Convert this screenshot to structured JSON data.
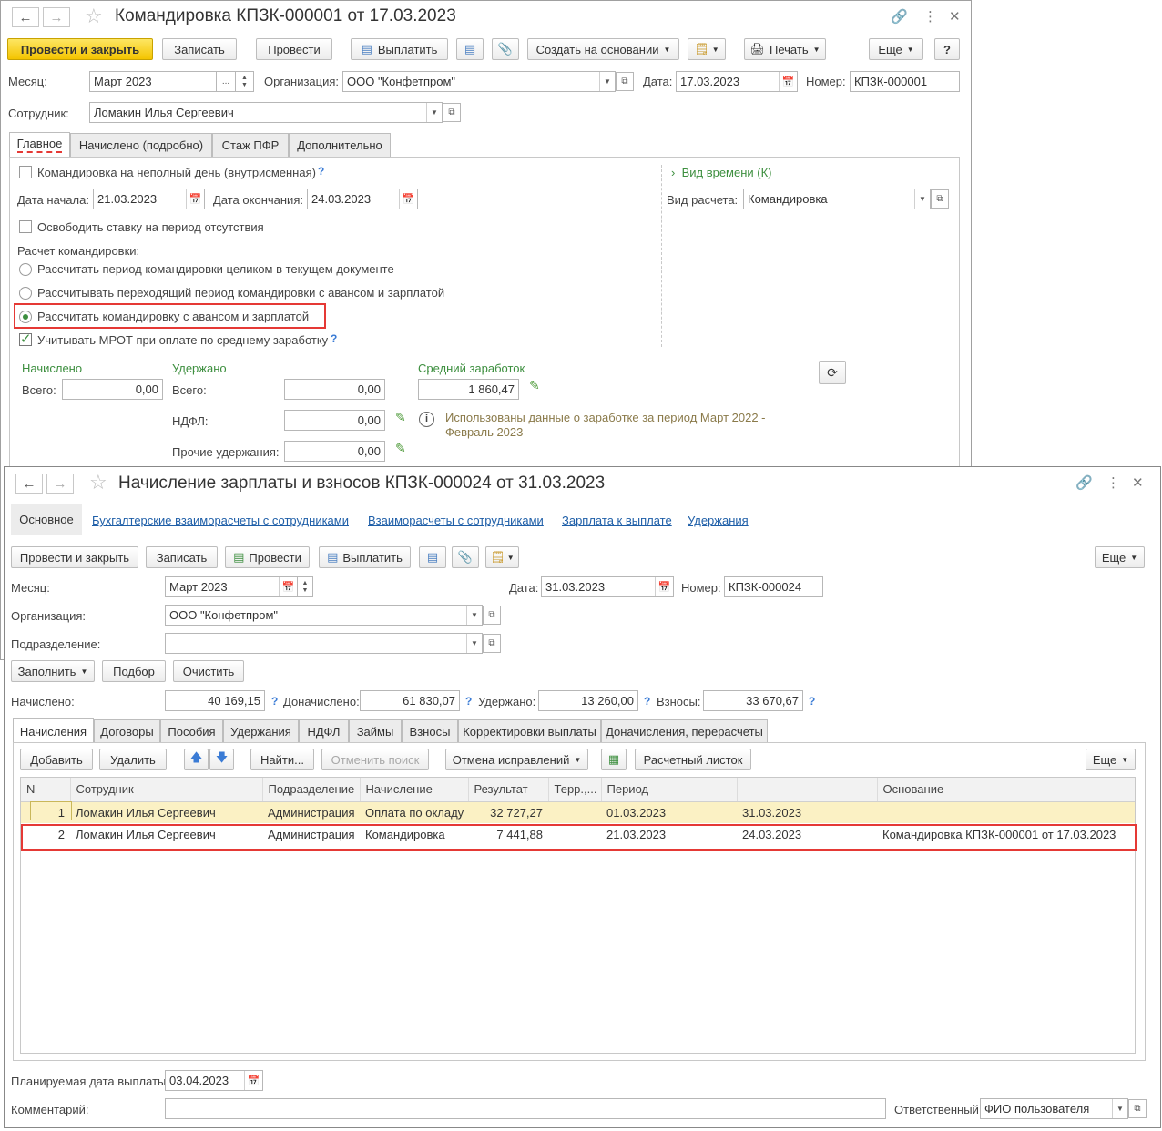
{
  "w1": {
    "title": "Командировка КПЗК-000001 от 17.03.2023",
    "toolbar": {
      "post_close": "Провести и закрыть",
      "save": "Записать",
      "post": "Провести",
      "pay": "Выплатить",
      "create_based": "Создать на основании",
      "print": "Печать",
      "more": "Еще",
      "help": "?"
    },
    "month_label": "Месяц:",
    "month_value": "Март 2023",
    "org_label": "Организация:",
    "org_value": "ООО \"Конфетпром\"",
    "date_label": "Дата:",
    "date_value": "17.03.2023",
    "number_label": "Номер:",
    "number_value": "КПЗК-000001",
    "employee_label": "Сотрудник:",
    "employee_value": "Ломакин Илья Сергеевич",
    "tabs": [
      "Главное",
      "Начислено (подробно)",
      "Стаж ПФР",
      "Дополнительно"
    ],
    "partial_day": "Командировка на неполный день (внутрисменная)",
    "start_label": "Дата начала:",
    "start_value": "21.03.2023",
    "end_label": "Дата окончания:",
    "end_value": "24.03.2023",
    "free_rate": "Освободить ставку на период отсутствия",
    "calc_header": "Расчет командировки:",
    "calc_options": [
      "Рассчитать период командировки целиком в текущем документе",
      "Рассчитывать переходящий период командировки с авансом и зарплатой",
      "Рассчитать командировку с авансом и зарплатой"
    ],
    "mrot": "Учитывать МРОТ при оплате по среднему заработку",
    "time_type": "Вид времени (К)",
    "calc_type_label": "Вид расчета:",
    "calc_type_value": "Командировка",
    "accrued_header": "Начислено",
    "accrued_total_label": "Всего:",
    "accrued_total": "0,00",
    "withheld_header": "Удержано",
    "withheld_total_label": "Всего:",
    "withheld_total": "0,00",
    "ndfl_label": "НДФЛ:",
    "ndfl_value": "0,00",
    "other_label": "Прочие удержания:",
    "other_value": "0,00",
    "avg_header": "Средний заработок",
    "avg_value": "1 860,47",
    "info_text_1": "Использованы данные о заработке за период Март 2022 -",
    "info_text_2": "Февраль 2023"
  },
  "w2": {
    "title": "Начисление зарплаты и взносов КПЗК-000024 от 31.03.2023",
    "sections": [
      "Основное",
      "Бухгалтерские взаиморасчеты с сотрудниками",
      "Взаиморасчеты с сотрудниками",
      "Зарплата к выплате",
      "Удержания"
    ],
    "toolbar": {
      "post_close": "Провести и закрыть",
      "save": "Записать",
      "post": "Провести",
      "pay": "Выплатить",
      "more": "Еще"
    },
    "month_label": "Месяц:",
    "month_value": "Март 2023",
    "date_label": "Дата:",
    "date_value": "31.03.2023",
    "number_label": "Номер:",
    "number_value": "КПЗК-000024",
    "org_label": "Организация:",
    "org_value": "ООО \"Конфетпром\"",
    "dept_label": "Подразделение:",
    "dept_value": "",
    "fill": "Заполнить",
    "select": "Подбор",
    "clear": "Очистить",
    "accrued_label": "Начислено:",
    "accrued_value": "40 169,15",
    "add_accrued_label": "Доначислено:",
    "add_accrued_value": "61 830,07",
    "withheld_label": "Удержано:",
    "withheld_value": "13 260,00",
    "contrib_label": "Взносы:",
    "contrib_value": "33 670,67",
    "tabs": [
      "Начисления",
      "Договоры",
      "Пособия",
      "Удержания",
      "НДФЛ",
      "Займы",
      "Взносы",
      "Корректировки выплаты",
      "Доначисления, перерасчеты"
    ],
    "tbl_toolbar": {
      "add": "Добавить",
      "delete": "Удалить",
      "find": "Найти...",
      "cancel_search": "Отменить поиск",
      "cancel_fix": "Отмена исправлений",
      "payslip": "Расчетный листок",
      "more": "Еще"
    },
    "columns": [
      "N",
      "Сотрудник",
      "Подразделение",
      "Начисление",
      "Результат",
      "Терр.,...",
      "Период",
      "",
      "Основание"
    ],
    "rows": [
      [
        "1",
        "Ломакин Илья Сергеевич",
        "Администрация",
        "Оплата по окладу",
        "32 727,27",
        "",
        "01.03.2023",
        "31.03.2023",
        ""
      ],
      [
        "2",
        "Ломакин Илья Сергеевич",
        "Администрация",
        "Командировка",
        "7 441,88",
        "",
        "21.03.2023",
        "24.03.2023",
        "Командировка КПЗК-000001 от 17.03.2023"
      ]
    ],
    "pay_date_label": "Планируемая дата выплаты:",
    "pay_date_value": "03.04.2023",
    "comment_label": "Комментарий:",
    "comment_value": "",
    "responsible_label": "Ответственный:",
    "responsible_value": "ФИО пользователя"
  }
}
